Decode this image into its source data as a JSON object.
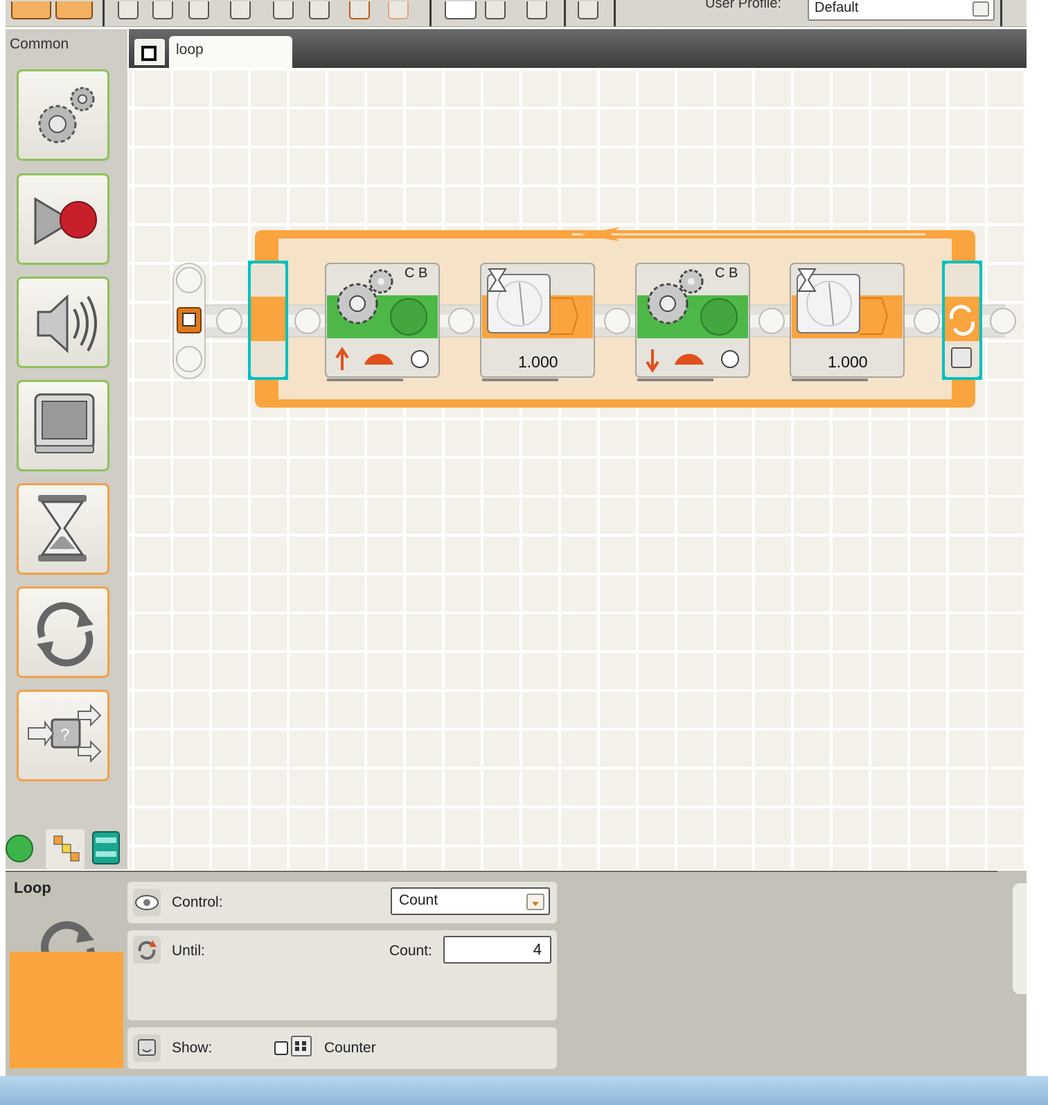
{
  "toolbar": {
    "profile_label": "User Profile:",
    "profile_value": "Default"
  },
  "palette": {
    "title": "Common",
    "items": [
      {
        "icon": "move-gears-icon"
      },
      {
        "icon": "record-play-icon"
      },
      {
        "icon": "sound-icon"
      },
      {
        "icon": "display-icon"
      },
      {
        "icon": "wait-hourglass-icon"
      },
      {
        "icon": "loop-icon"
      },
      {
        "icon": "switch-icon"
      }
    ],
    "tabs": [
      {
        "icon": "common-palette-icon"
      },
      {
        "icon": "complete-palette-icon"
      },
      {
        "icon": "custom-palette-icon"
      }
    ]
  },
  "canvas": {
    "tab_title": "loop",
    "blocks": [
      {
        "type": "move",
        "ports": "C B",
        "direction": "up"
      },
      {
        "type": "wait-time",
        "value": "1.000"
      },
      {
        "type": "move",
        "ports": "C B",
        "direction": "down"
      },
      {
        "type": "wait-time",
        "value": "1.000"
      }
    ]
  },
  "config": {
    "block_name": "Loop",
    "control_label": "Control:",
    "control_value": "Count",
    "until_label": "Until:",
    "count_label": "Count:",
    "count_value": "4",
    "show_label": "Show:",
    "counter_label": "Counter",
    "counter_checked": false
  },
  "colors": {
    "loop_orange": "#f9a43e",
    "move_green": "#4db847",
    "selection_cyan": "#32c8c8",
    "grid_bg": "#f3f1ea"
  }
}
